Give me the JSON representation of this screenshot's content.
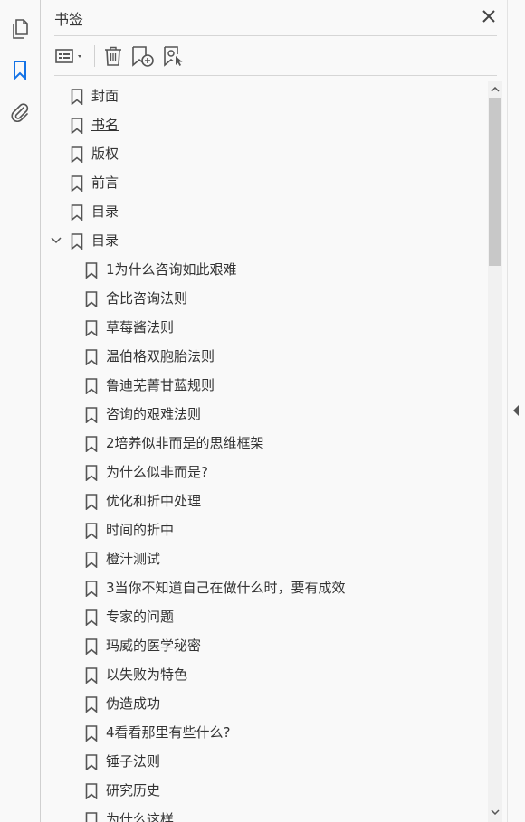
{
  "panel": {
    "title": "书签"
  },
  "icons": {
    "rail": [
      "pages-icon",
      "bookmark-icon",
      "attachment-icon"
    ],
    "toolbar": [
      "options-menu-icon",
      "delete-icon",
      "new-bookmark-icon",
      "bookmark-from-structure-icon"
    ],
    "close": "close-icon"
  },
  "colors": {
    "accent": "#1473e6",
    "text": "#333333",
    "icon": "#555555"
  },
  "bookmarks": [
    {
      "label": "封面",
      "level": 0
    },
    {
      "label": "书名",
      "level": 0,
      "underline": true
    },
    {
      "label": "版权",
      "level": 0
    },
    {
      "label": "前言",
      "level": 0
    },
    {
      "label": "目录",
      "level": 0
    },
    {
      "label": "目录",
      "level": 0,
      "expanded": true
    },
    {
      "label": "1为什么咨询如此艰难",
      "level": 1
    },
    {
      "label": "舍比咨询法则",
      "level": 1
    },
    {
      "label": "草莓酱法则",
      "level": 1
    },
    {
      "label": " 温伯格双胞胎法则",
      "level": 1
    },
    {
      "label": "鲁迪芜菁甘蓝规则",
      "level": 1
    },
    {
      "label": " 咨询的艰难法则",
      "level": 1
    },
    {
      "label": " 2培养似非而是的思维框架",
      "level": 1
    },
    {
      "label": "为什么似非而是?",
      "level": 1
    },
    {
      "label": "优化和折中处理",
      "level": 1
    },
    {
      "label": "时间的折中",
      "level": 1
    },
    {
      "label": "橙汁测试",
      "level": 1
    },
    {
      "label": "3当你不知道自己在做什么时，要有成效",
      "level": 1
    },
    {
      "label": "专家的问题",
      "level": 1
    },
    {
      "label": "玛威的医学秘密",
      "level": 1
    },
    {
      "label": " 以失败为特色",
      "level": 1
    },
    {
      "label": "伪造成功",
      "level": 1
    },
    {
      "label": "4看看那里有些什么?",
      "level": 1
    },
    {
      "label": "锤子法则",
      "level": 1
    },
    {
      "label": "研究历史",
      "level": 1
    },
    {
      "label": "为什么这样",
      "level": 1
    }
  ]
}
